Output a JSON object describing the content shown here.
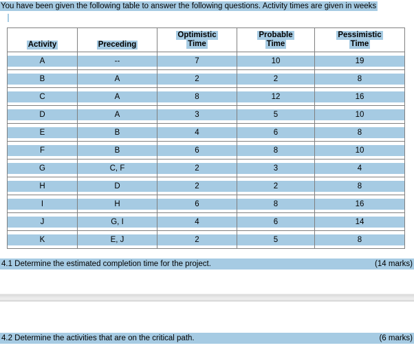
{
  "document": {
    "intro_text": "You have been given the following table to answer the following questions. Activity times are given in weeks",
    "highlight_color": "#a6cbe3",
    "border_color": "#7f7f7f"
  },
  "table": {
    "headers": [
      {
        "line1": "Activity",
        "line2": ""
      },
      {
        "line1": "Preceding",
        "line2": ""
      },
      {
        "line1": "Optimistic",
        "line2": "Time"
      },
      {
        "line1": "Probable",
        "line2": "Time"
      },
      {
        "line1": "Pessimistic",
        "line2": "Time"
      }
    ],
    "rows": [
      {
        "activity": "A",
        "preceding": "--",
        "optimistic": "7",
        "probable": "10",
        "pessimistic": "19"
      },
      {
        "activity": "B",
        "preceding": "A",
        "optimistic": "2",
        "probable": "2",
        "pessimistic": "8"
      },
      {
        "activity": "C",
        "preceding": "A",
        "optimistic": "8",
        "probable": "12",
        "pessimistic": "16"
      },
      {
        "activity": "D",
        "preceding": "A",
        "optimistic": "3",
        "probable": "5",
        "pessimistic": "10"
      },
      {
        "activity": "E",
        "preceding": "B",
        "optimistic": "4",
        "probable": "6",
        "pessimistic": "8"
      },
      {
        "activity": "F",
        "preceding": "B",
        "optimistic": "6",
        "probable": "8",
        "pessimistic": "10"
      },
      {
        "activity": "G",
        "preceding": "C, F",
        "optimistic": "2",
        "probable": "3",
        "pessimistic": "4"
      },
      {
        "activity": "H",
        "preceding": "D",
        "optimistic": "2",
        "probable": "2",
        "pessimistic": "8"
      },
      {
        "activity": "I",
        "preceding": "H",
        "optimistic": "6",
        "probable": "8",
        "pessimistic": "16"
      },
      {
        "activity": "J",
        "preceding": "G, I",
        "optimistic": "4",
        "probable": "6",
        "pessimistic": "14"
      },
      {
        "activity": "K",
        "preceding": "E, J",
        "optimistic": "2",
        "probable": "5",
        "pessimistic": "8"
      }
    ]
  },
  "questions": [
    {
      "text": "4.1 Determine the estimated completion time for the project.",
      "marks": "(14 marks)"
    },
    {
      "text": "4.2 Determine the activities that are on the critical path.",
      "marks": "(6 marks)"
    }
  ]
}
